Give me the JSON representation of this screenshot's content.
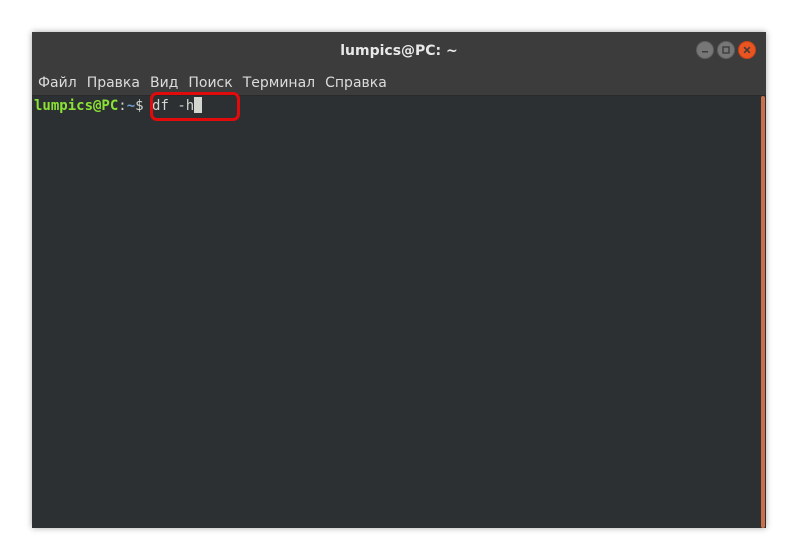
{
  "window": {
    "title": "lumpics@PC: ~"
  },
  "menubar": {
    "items": [
      "Файл",
      "Правка",
      "Вид",
      "Поиск",
      "Терминал",
      "Справка"
    ]
  },
  "terminal": {
    "prompt_user": "lumpics@PC",
    "prompt_sep": ":",
    "prompt_path": "~",
    "prompt_dollar": "$",
    "command": " df -h"
  },
  "colors": {
    "background": "#2d3033",
    "titlebar": "#3c3c3c",
    "prompt_user": "#8ae234",
    "prompt_path": "#729fcf",
    "text": "#d3d7cf",
    "close_button": "#e95420",
    "scrollbar": "#c9704a",
    "highlight": "#e20b0b"
  },
  "icons": {
    "minimize": "minimize-icon",
    "maximize": "maximize-icon",
    "close": "close-icon"
  }
}
